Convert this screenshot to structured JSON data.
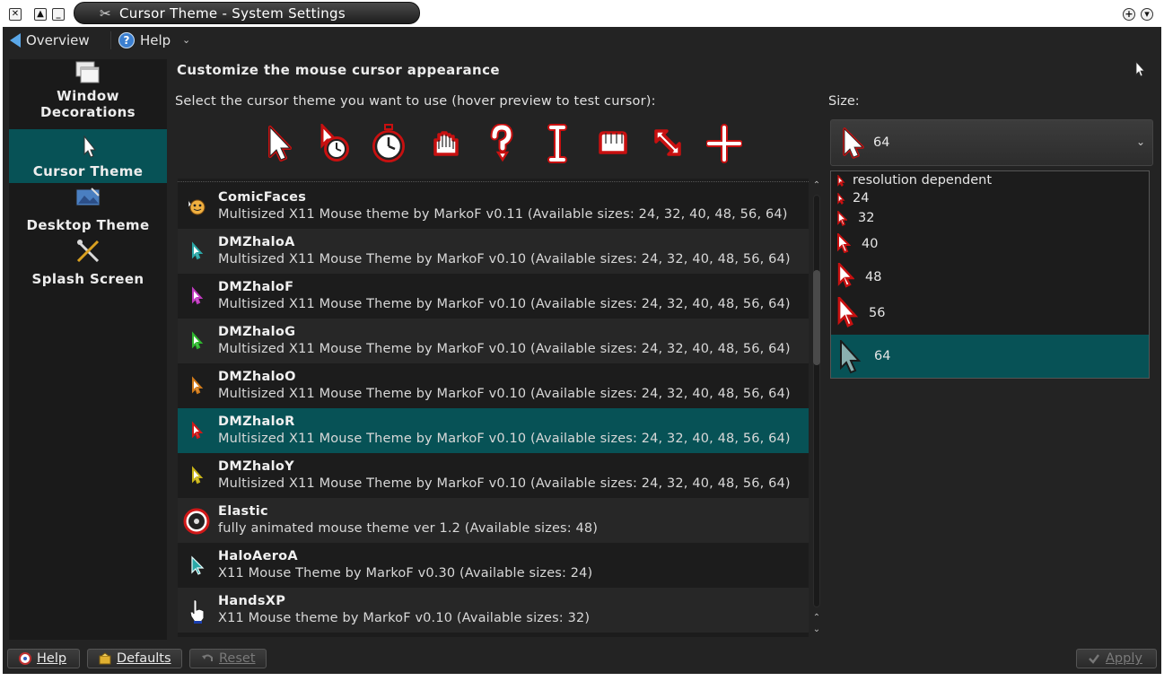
{
  "window": {
    "title": "Cursor Theme - System Settings"
  },
  "toolbar": {
    "overview_label": "Overview",
    "help_label": "Help"
  },
  "sidebar": {
    "items": [
      {
        "label": "Window\nDecorations",
        "line1": "Window",
        "line2": "Decorations"
      },
      {
        "label": "Cursor Theme"
      },
      {
        "label": "Desktop Theme"
      },
      {
        "label": "Splash Screen"
      }
    ],
    "active": "Cursor Theme"
  },
  "main": {
    "heading": "Customize the mouse cursor appearance",
    "select_label": "Select the cursor theme you want to use (hover preview to test cursor):",
    "size_label": "Size:"
  },
  "preview_icons": [
    "arrow-cursor-icon",
    "busy-cursor-icon",
    "wait-cursor-icon",
    "grab-hand-icon",
    "help-cursor-icon",
    "text-cursor-icon",
    "closed-hand-icon",
    "resize-diagonal-icon",
    "crosshair-icon"
  ],
  "themes": [
    {
      "name": "ComicFaces",
      "desc": "Multisized X11 Mouse theme by MarkoF v0.11 (Available sizes: 24, 32, 40, 48, 56, 64)",
      "icon_color": "#e0a030"
    },
    {
      "name": "DMZhaloA",
      "desc": "Multisized X11 Mouse Theme by MarkoF v0.10 (Available sizes: 24, 32, 40, 48, 56, 64)",
      "icon_color": "#2aa7a7"
    },
    {
      "name": "DMZhaloF",
      "desc": "Multisized X11 Mouse Theme by MarkoF v0.10 (Available sizes: 24, 32, 40, 48, 56, 64)",
      "icon_color": "#c03ac0"
    },
    {
      "name": "DMZhaloG",
      "desc": "Multisized X11 Mouse Theme by MarkoF v0.10 (Available sizes: 24, 32, 40, 48, 56, 64)",
      "icon_color": "#2eb82e"
    },
    {
      "name": "DMZhaloO",
      "desc": "Multisized X11 Mouse Theme by MarkoF v0.10 (Available sizes: 24, 32, 40, 48, 56, 64)",
      "icon_color": "#d07a1a"
    },
    {
      "name": "DMZhaloR",
      "desc": "Multisized X11 Mouse Theme by MarkoF v0.10 (Available sizes: 24, 32, 40, 48, 56, 64)",
      "icon_color": "#d01818"
    },
    {
      "name": "DMZhaloY",
      "desc": "Multisized X11 Mouse Theme by MarkoF v0.10 (Available sizes: 24, 32, 40, 48, 56, 64)",
      "icon_color": "#c8b418"
    },
    {
      "name": "Elastic",
      "desc": "fully animated mouse theme ver 1.2 (Available sizes: 48)",
      "icon_color": "#d01818"
    },
    {
      "name": "HaloAeroA",
      "desc": "X11 Mouse Theme by MarkoF v0.30 (Available sizes: 24)",
      "icon_color": "#2aa7a7"
    },
    {
      "name": "HandsXP",
      "desc": "X11 Mouse theme by MarkoF v0.10 (Available sizes: 32)",
      "icon_color": "#ffffff"
    }
  ],
  "selected_theme": "DMZhaloR",
  "size": {
    "current": "64",
    "options": [
      "resolution dependent",
      "24",
      "32",
      "40",
      "48",
      "56",
      "64"
    ]
  },
  "buttons": {
    "help": "Help",
    "defaults": "Defaults",
    "reset": "Reset",
    "apply": "Apply"
  },
  "colors": {
    "selection": "#075256",
    "halo_red": "#c81010"
  }
}
